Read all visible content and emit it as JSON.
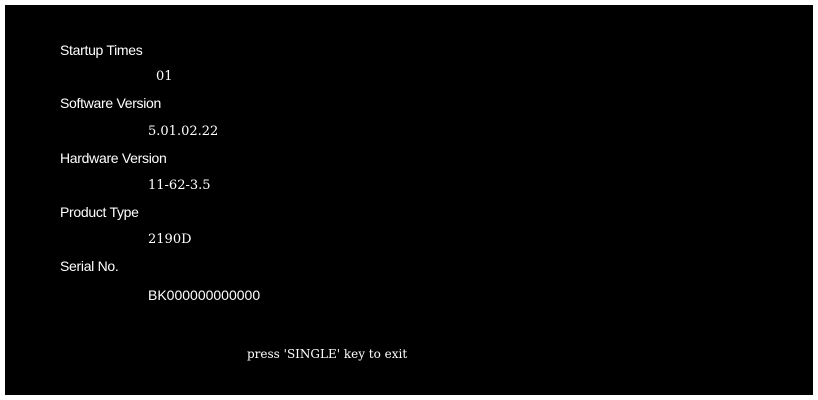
{
  "info": {
    "startup_times": {
      "label": "Startup Times",
      "value": "01"
    },
    "software_version": {
      "label": "Software Version",
      "value": "5.01.02.22"
    },
    "hardware_version": {
      "label": "Hardware Version",
      "value": "11-62-3.5"
    },
    "product_type": {
      "label": "Product Type",
      "value": "2190D"
    },
    "serial_no": {
      "label": "Serial No.",
      "value": "BK000000000000"
    }
  },
  "footer": {
    "exit_hint": "press 'SINGLE' key to exit"
  },
  "colors": {
    "background": "#000000",
    "text": "#ffffff"
  }
}
